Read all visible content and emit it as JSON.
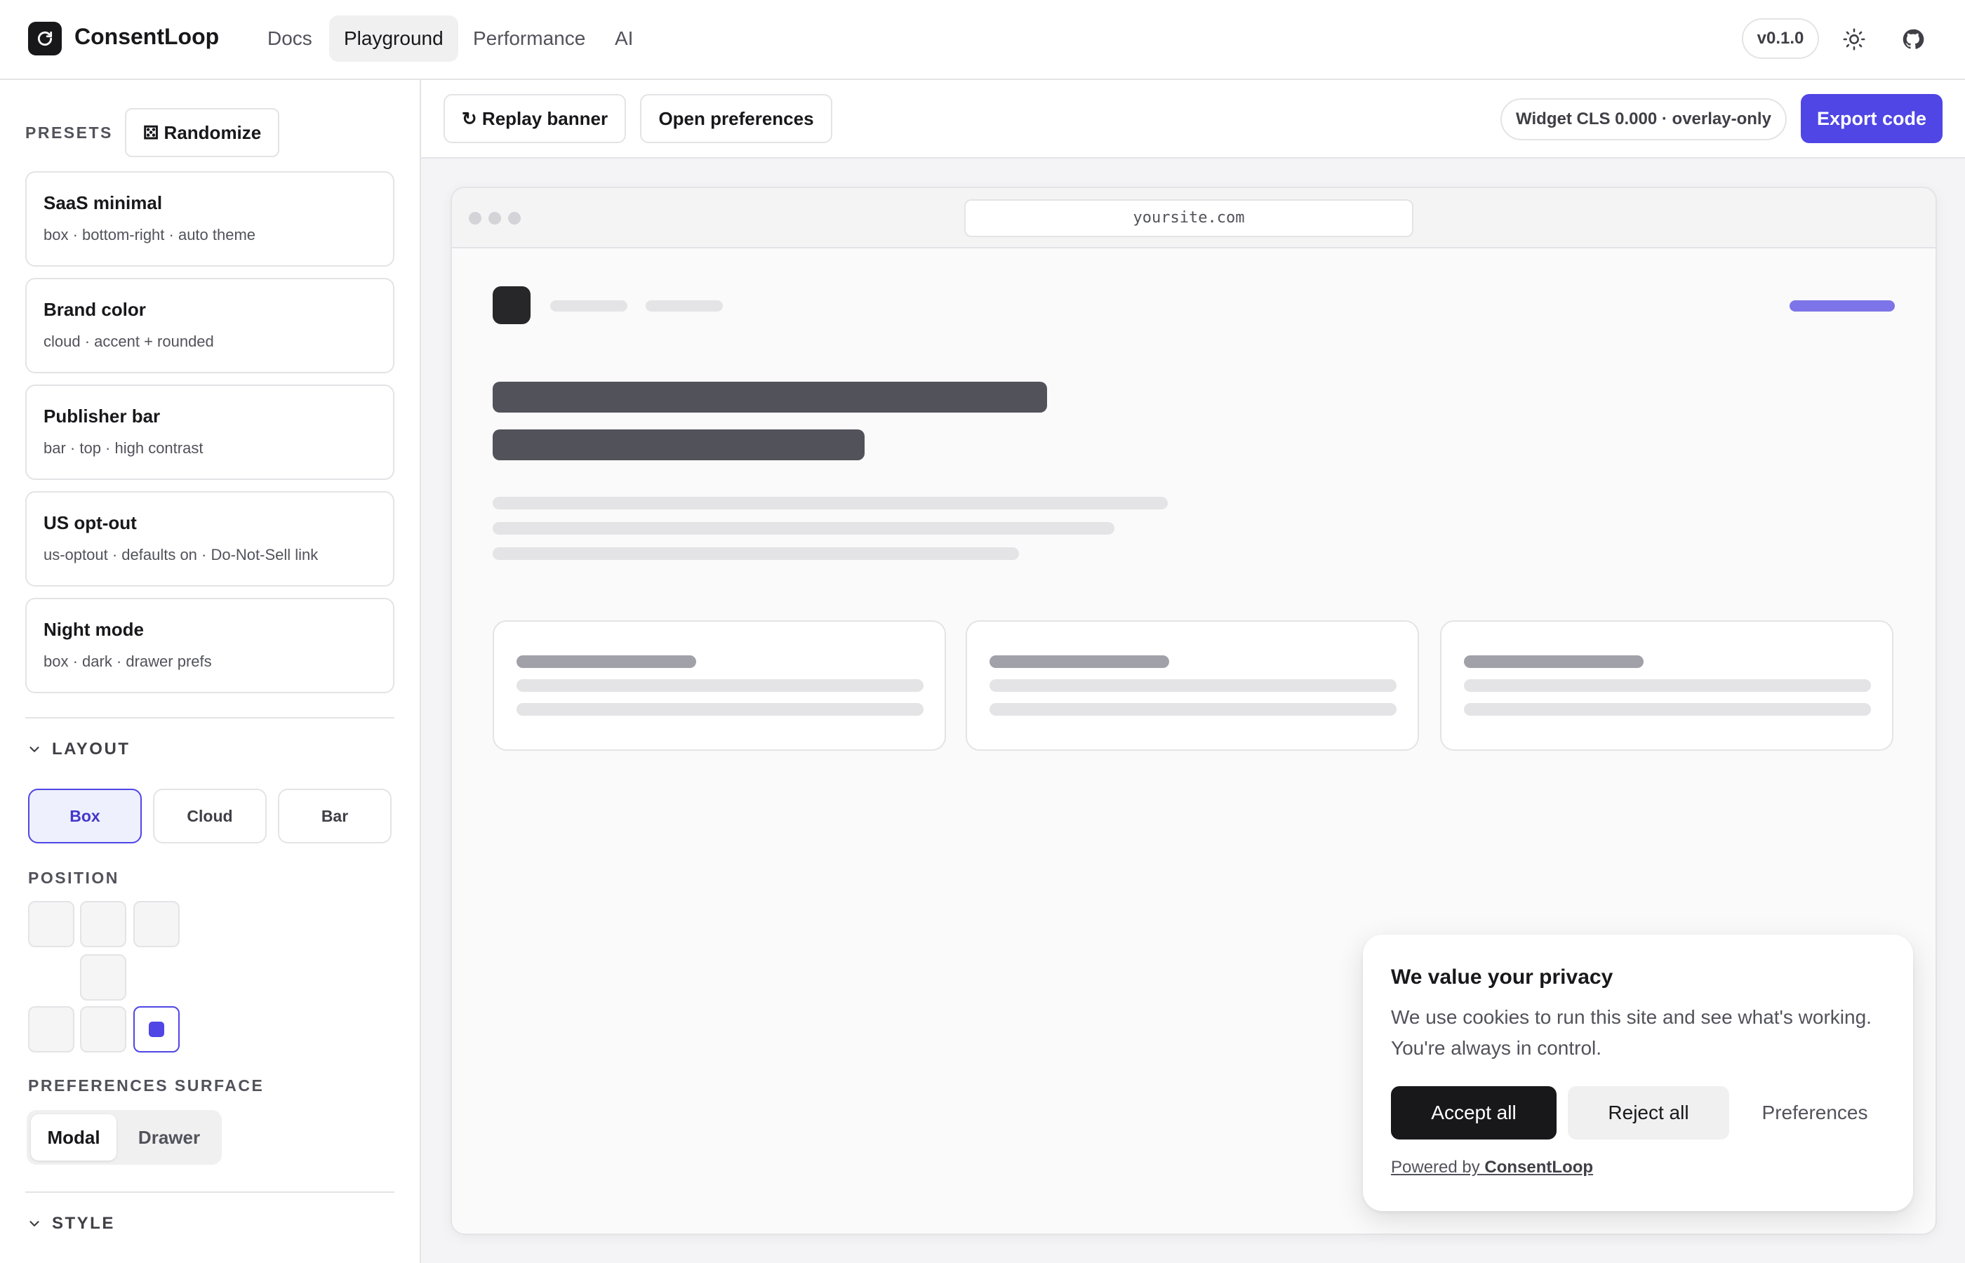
{
  "nav": {
    "brand": "ConsentLoop",
    "links": [
      {
        "label": "Docs",
        "active": false
      },
      {
        "label": "Playground",
        "active": true
      },
      {
        "label": "Performance",
        "active": false
      },
      {
        "label": "AI",
        "active": false
      }
    ],
    "version": "v0.1.0",
    "icons": [
      "refresh-loop-icon",
      "sun-icon",
      "github-icon"
    ]
  },
  "sidebar": {
    "presets_label": "PRESETS",
    "randomize_label": "⚄ Randomize",
    "presets": [
      {
        "name": "SaaS minimal",
        "desc": "box · bottom-right · auto theme"
      },
      {
        "name": "Brand color",
        "desc": "cloud · accent + rounded"
      },
      {
        "name": "Publisher bar",
        "desc": "bar · top · high contrast"
      },
      {
        "name": "US opt-out",
        "desc": "us-optout · defaults on · Do-Not-Sell link"
      },
      {
        "name": "Night mode",
        "desc": "box · dark · drawer prefs"
      }
    ],
    "layout_label": "LAYOUT",
    "layout_options": [
      {
        "label": "Box",
        "selected": true
      },
      {
        "label": "Cloud",
        "selected": false
      },
      {
        "label": "Bar",
        "selected": false
      }
    ],
    "position_label": "POSITION",
    "position_selected": "bottom-right",
    "prefs_surface_label": "PREFERENCES SURFACE",
    "prefs_surface_options": [
      {
        "label": "Modal",
        "active": true
      },
      {
        "label": "Drawer",
        "active": false
      }
    ],
    "style_label": "STYLE"
  },
  "toolbar": {
    "replay_label": "↻ Replay banner",
    "open_prefs_label": "Open preferences",
    "cls_badge": "Widget CLS 0.000 · overlay-only",
    "export_label": "Export code"
  },
  "preview": {
    "url": "yoursite.com"
  },
  "banner": {
    "title": "We value your privacy",
    "body": "We use cookies to run this site and see what's working. You're always in control.",
    "accept_label": "Accept all",
    "reject_label": "Reject all",
    "preferences_label": "Preferences",
    "powered_prefix": "Powered by ",
    "powered_brand": "ConsentLoop"
  },
  "colors": {
    "accent": "#4f46e5",
    "dark": "#18181b",
    "border": "#e4e4e7"
  }
}
